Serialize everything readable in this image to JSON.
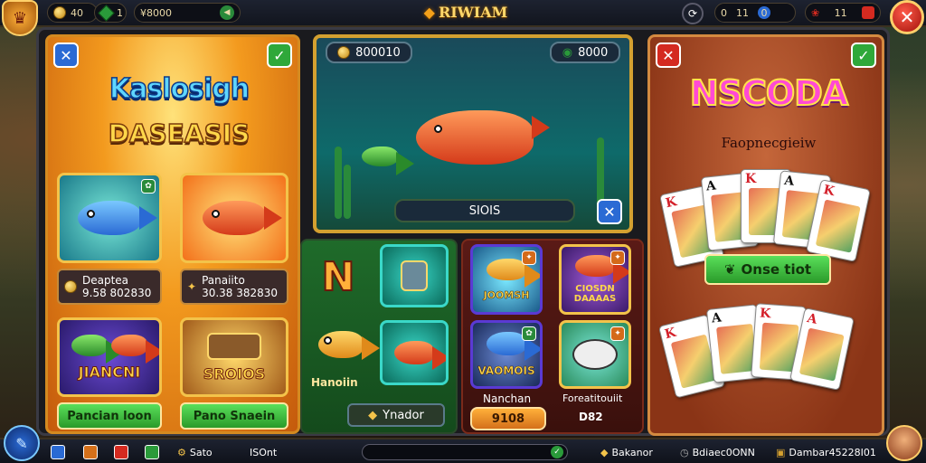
{
  "topbar": {
    "coin_value": "0",
    "coin_suffix": "40",
    "gem_label": "1",
    "balance": "¥8000",
    "title": "RIWIAM",
    "counter_a": "0",
    "counter_b": "11",
    "counter_c": "0",
    "level": "11"
  },
  "left_panel": {
    "title_line1": "Kaslosigh",
    "title_line2": "DASEASIS",
    "tiles": [
      {
        "label_top": "Deaptea",
        "label_bottom": "9.58 802830"
      },
      {
        "label_top": "Panaiito",
        "label_bottom": "30.38 382830"
      }
    ],
    "tile_row2": [
      {
        "caption": "JIANCNI"
      },
      {
        "caption": "SROIOS"
      }
    ],
    "buttons": [
      "Pancian loon",
      "Pano Snaein"
    ]
  },
  "mid_top": {
    "left_value": "800010",
    "right_value": "8000",
    "bottom_label": "SIOIS"
  },
  "mid_left": {
    "big_letter": "N",
    "fish_label": "Hanoiin",
    "button": "Ynador"
  },
  "mid_right": {
    "tiles": [
      {
        "caption": "JOOMSH"
      },
      {
        "caption": "CIOSDN\nDAAAAS"
      },
      {
        "caption": "VAOMOIS"
      },
      {
        "caption": ""
      }
    ],
    "footer_left": "Nanchan",
    "footer_right": "Foreatitouiit",
    "pill_left": "9108",
    "pill_right": "D82"
  },
  "right_panel": {
    "title": "NSCODA",
    "subtitle": "Faopnecgieiw",
    "button": "Onse tiot",
    "card_ranks_top": [
      "K",
      "A",
      "K",
      "A",
      "K"
    ],
    "card_ranks_bottom": [
      "K",
      "A",
      "K",
      "A"
    ]
  },
  "bottombar": {
    "item1": "Sato",
    "item2": "ISOnt",
    "item3": "Bakanor",
    "item4": "Bdiaec0ONN",
    "item5": "Dambar45228I01"
  },
  "colors": {
    "accent_gold": "#f3c34a",
    "green_button": "#2fa83a",
    "red_button": "#d42a20"
  }
}
